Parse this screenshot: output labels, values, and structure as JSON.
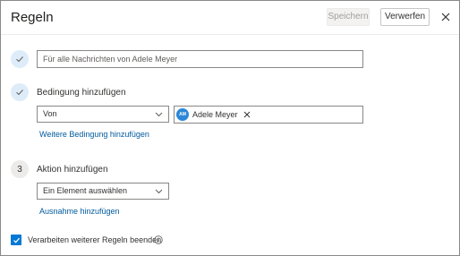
{
  "dialog": {
    "title": "Regeln",
    "save_label": "Speichern",
    "discard_label": "Verwerfen",
    "close_icon": "close-icon"
  },
  "rule_name": {
    "value": "Für alle Nachrichten von Adele Meyer"
  },
  "condition": {
    "heading": "Bedingung hinzufügen",
    "selected": "Von",
    "recipient": {
      "initials": "AM",
      "name": "Adele Meyer"
    },
    "add_link": "Weitere Bedingung hinzufügen"
  },
  "action": {
    "step_number": "3",
    "heading": "Aktion hinzufügen",
    "placeholder": "Ein Element auswählen",
    "exception_link": "Ausnahme hinzufügen"
  },
  "stop_processing": {
    "label": "Verarbeiten weiterer Regeln beenden",
    "checked": true
  },
  "colors": {
    "accent": "#0078d4",
    "link": "#005a9e",
    "avatar": "#2b88d8",
    "step_done_bg": "#deecf9"
  }
}
